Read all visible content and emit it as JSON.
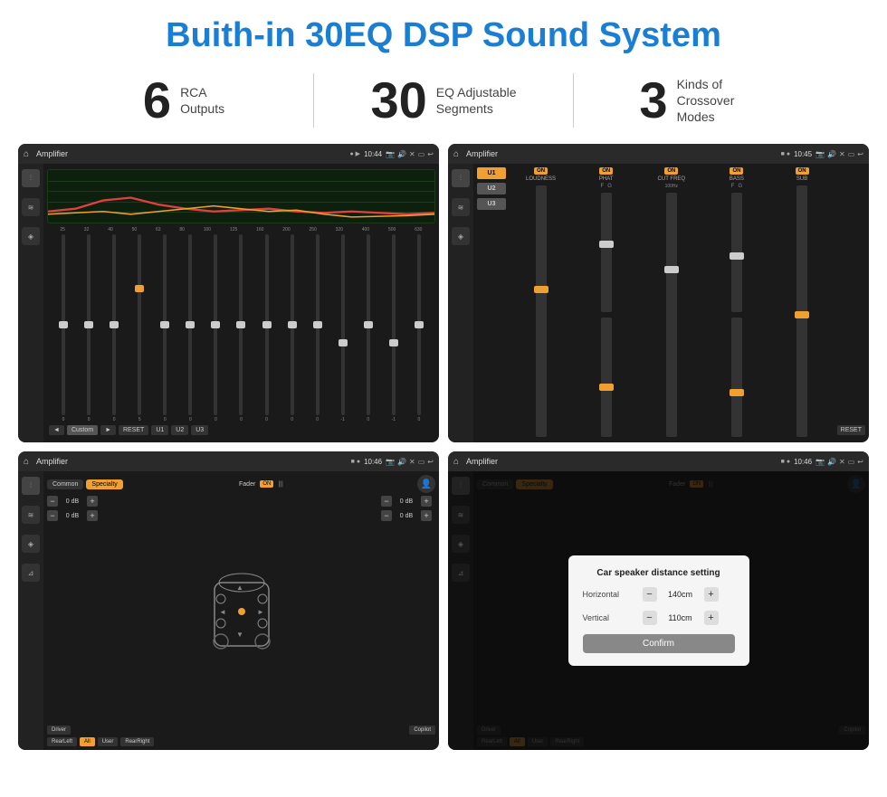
{
  "page": {
    "title": "Buith-in 30EQ DSP Sound System",
    "stats": [
      {
        "number": "6",
        "label": "RCA\nOutputs"
      },
      {
        "number": "30",
        "label": "EQ Adjustable\nSegments"
      },
      {
        "number": "3",
        "label": "Kinds of\nCrossover Modes"
      }
    ],
    "screens": [
      {
        "id": "eq-screen",
        "topbar_title": "Amplifier",
        "topbar_time": "10:44",
        "type": "eq"
      },
      {
        "id": "amp2-screen",
        "topbar_title": "Amplifier",
        "topbar_time": "10:45",
        "type": "amp2"
      },
      {
        "id": "amp3-screen",
        "topbar_title": "Amplifier",
        "topbar_time": "10:46",
        "type": "amp3"
      },
      {
        "id": "amp4-screen",
        "topbar_title": "Amplifier",
        "topbar_time": "10:46",
        "type": "amp4"
      }
    ],
    "eq": {
      "frequencies": [
        "25",
        "32",
        "40",
        "50",
        "63",
        "80",
        "100",
        "125",
        "160",
        "200",
        "250",
        "320",
        "400",
        "500",
        "630"
      ],
      "values": [
        "0",
        "0",
        "0",
        "5",
        "0",
        "0",
        "0",
        "0",
        "0",
        "0",
        "0",
        "-1",
        "0",
        "-1"
      ],
      "buttons": [
        "◄",
        "Custom",
        "►",
        "RESET",
        "U1",
        "U2",
        "U3"
      ]
    },
    "amp2": {
      "presets": [
        "U1",
        "U2",
        "U3"
      ],
      "channels": [
        "LOUDNESS",
        "PHAT",
        "CUT FREQ",
        "BASS",
        "SUB"
      ],
      "reset": "RESET"
    },
    "amp3": {
      "tabs": [
        "Common",
        "Specialty"
      ],
      "fader": "Fader",
      "fader_on": "ON",
      "db_values": [
        "0 dB",
        "0 dB",
        "0 dB",
        "0 dB"
      ],
      "btns": [
        "Driver",
        "Copilot",
        "RearLeft",
        "All",
        "User",
        "RearRight"
      ]
    },
    "amp4": {
      "dialog": {
        "title": "Car speaker distance setting",
        "horizontal_label": "Horizontal",
        "horizontal_value": "140cm",
        "vertical_label": "Vertical",
        "vertical_value": "110cm",
        "confirm_btn": "Confirm"
      },
      "btns": [
        "Driver",
        "Copilot",
        "RearLeft",
        "All",
        "User",
        "RearRight"
      ]
    }
  }
}
